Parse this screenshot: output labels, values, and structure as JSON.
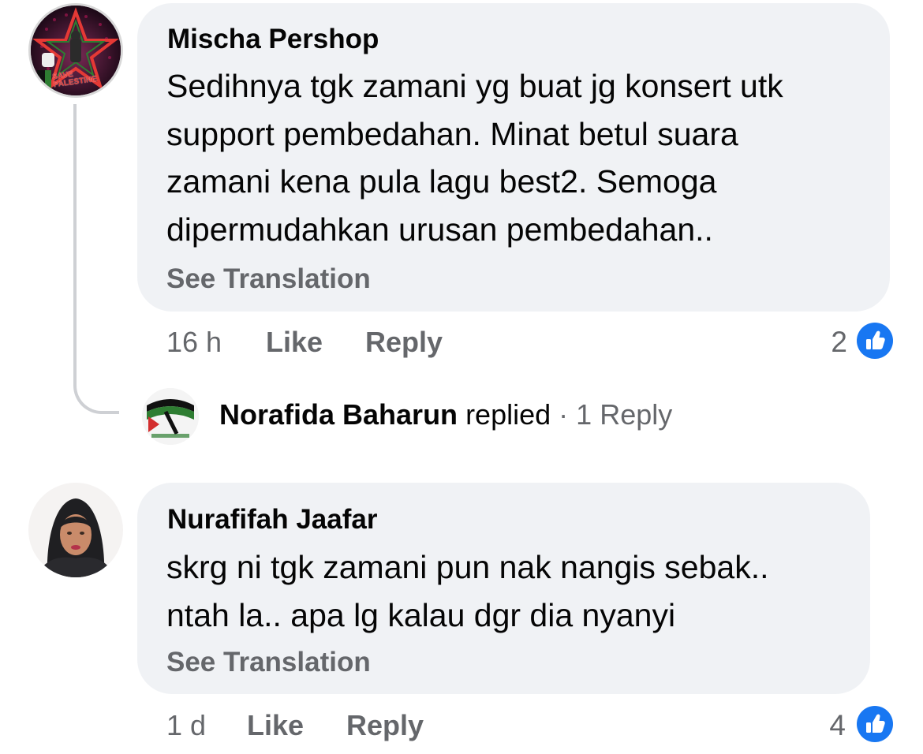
{
  "comments": [
    {
      "author": "Mischa Pershop",
      "lines": [
        "Sedihnya tgk zamani yg buat jg konsert utk",
        "support pembedahan. Minat betul suara",
        "zamani kena pula lagu best2. Semoga",
        "dipermudahkan urusan pembedahan.."
      ],
      "see_translation": "See Translation",
      "time": "16 h",
      "like_label": "Like",
      "reply_label": "Reply",
      "like_count": "2",
      "avatar_icon": "avatar-save-palestine",
      "avatar_caption": "SAVE PALESTINE",
      "replied": {
        "name": "Norafida Baharun",
        "verb": "replied",
        "separator": "·",
        "count": "1 Reply"
      }
    },
    {
      "author": "Nurafifah Jaafar",
      "lines": [
        "skrg ni tgk zamani pun nak nangis sebak..",
        "ntah la.. apa lg kalau dgr dia nyanyi"
      ],
      "see_translation": "See Translation",
      "time": "1 d",
      "like_label": "Like",
      "reply_label": "Reply",
      "like_count": "4",
      "avatar_icon": "avatar-woman-hijab"
    }
  ],
  "colors": {
    "bubble": "#f0f2f5",
    "text": "#050505",
    "secondary": "#65676b",
    "like_blue": "#1877f2",
    "thread_line": "#ced0d4"
  }
}
